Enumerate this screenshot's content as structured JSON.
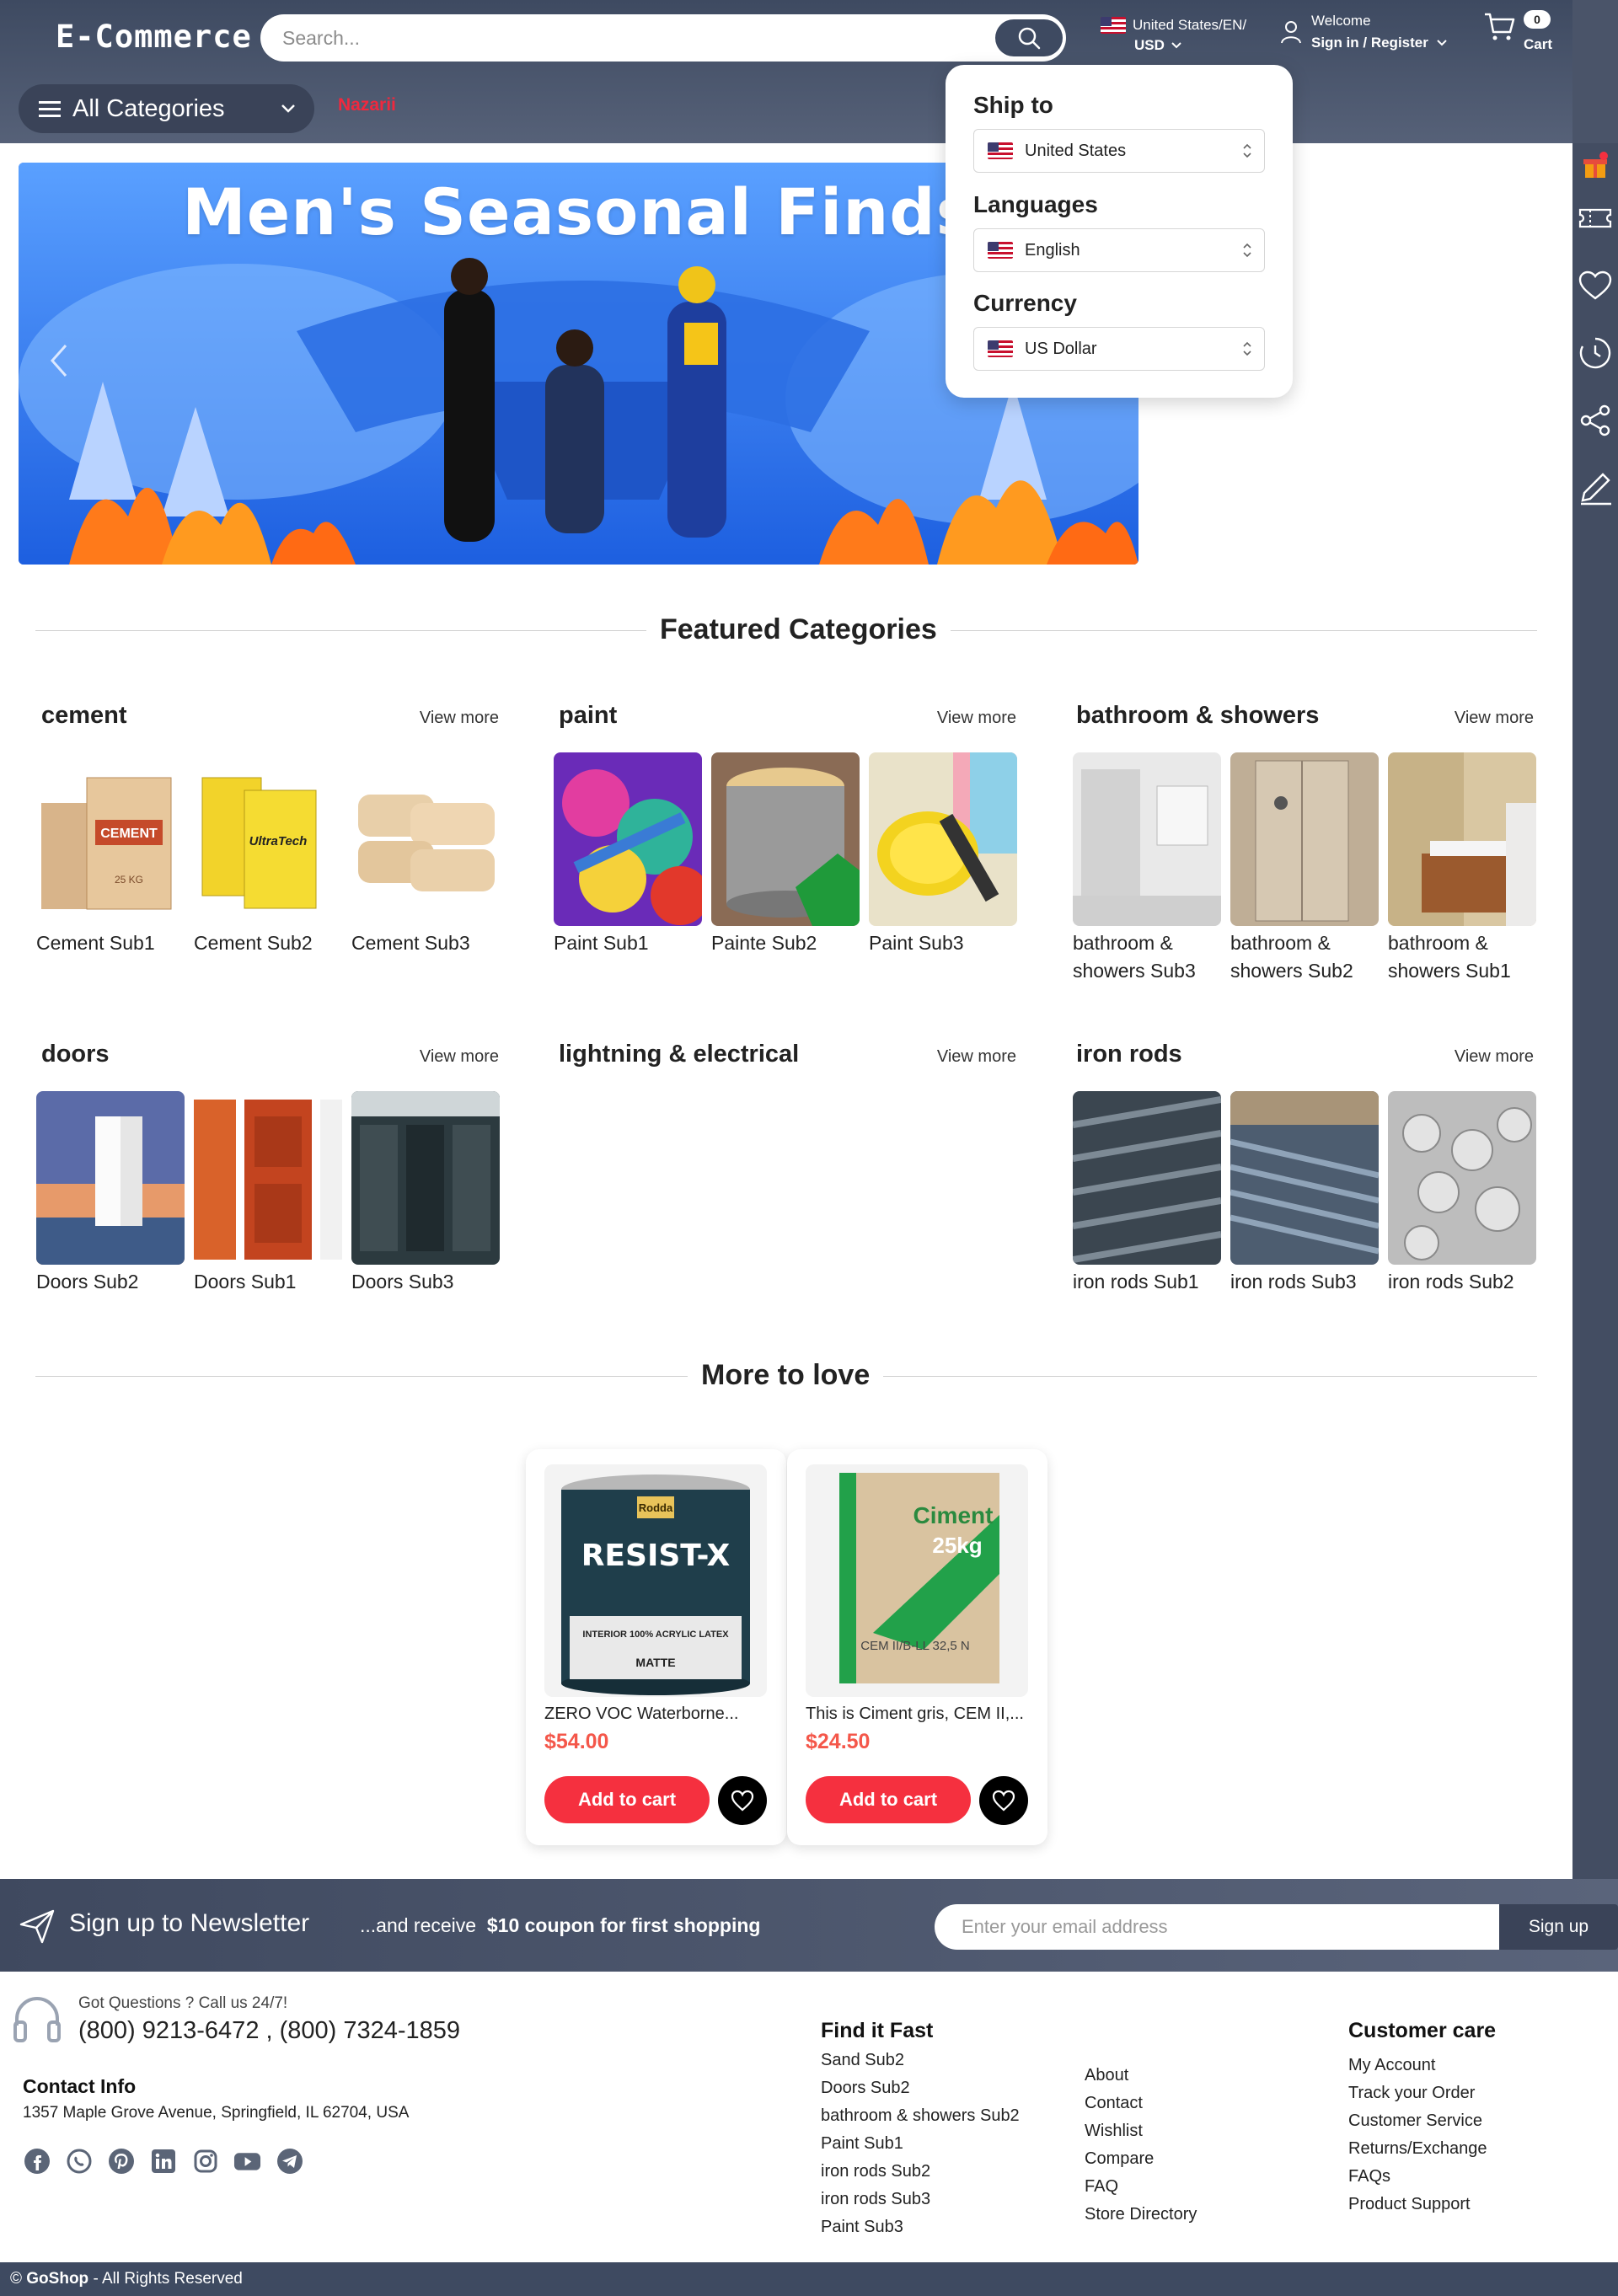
{
  "header": {
    "logo": "E-Commerce",
    "search_placeholder": "Search...",
    "locale_line1": "United States/EN/",
    "locale_line2": "USD",
    "welcome": "Welcome",
    "sign_in": "Sign in / Register",
    "cart_count": "0",
    "cart_label": "Cart",
    "all_categories": "All Categories",
    "nav_link": "Nazarii"
  },
  "dropdown": {
    "ship_to_title": "Ship to",
    "ship_to_value": "United States",
    "languages_title": "Languages",
    "languages_value": "English",
    "currency_title": "Currency",
    "currency_value": "US Dollar"
  },
  "hero": {
    "title": "Men's Seasonal Finds"
  },
  "featured": {
    "title": "Featured Categories",
    "view_more": "View more",
    "categories": [
      {
        "name": "cement",
        "items": [
          "Cement Sub1",
          "Cement Sub2",
          "Cement Sub3"
        ]
      },
      {
        "name": "paint",
        "items": [
          "Paint Sub1",
          "Painte Sub2",
          "Paint Sub3"
        ]
      },
      {
        "name": "bathroom & showers",
        "items": [
          "bathroom & showers Sub3",
          "bathroom & showers Sub2",
          "bathroom & showers Sub1"
        ]
      },
      {
        "name": "doors",
        "items": [
          "Doors Sub2",
          "Doors Sub1",
          "Doors Sub3"
        ]
      },
      {
        "name": "lightning & electrical",
        "items": []
      },
      {
        "name": "iron rods",
        "items": [
          "iron rods Sub1",
          "iron rods Sub3",
          "iron rods Sub2"
        ]
      }
    ]
  },
  "more_to_love": {
    "title": "More to love",
    "products": [
      {
        "name": "ZERO VOC Waterborne...",
        "price": "$54.00",
        "add_label": "Add to cart",
        "image_text_brand": "Rodda",
        "image_text_product": "RESIST-X",
        "image_text_desc": "INTERIOR 100% ACRYLIC LATEX",
        "image_text_finish": "MATTE"
      },
      {
        "name": "This is Ciment gris, CEM II,...",
        "price": "$24.50",
        "add_label": "Add to cart",
        "image_text_brand": "Ciment",
        "image_text_weight": "25kg",
        "image_text_spec": "CEM II/B-LL 32,5 N"
      }
    ]
  },
  "newsletter": {
    "title": "Sign up to Newsletter",
    "receive": "...and receive",
    "coupon": "$10 coupon for first shopping",
    "placeholder": "Enter your email address",
    "button": "Sign up"
  },
  "footer": {
    "questions": "Got Questions ? Call us 24/7!",
    "phones": "(800) 9213-6472 , (800) 7324-1859",
    "contact_title": "Contact Info",
    "address": "1357 Maple Grove Avenue, Springfield, IL 62704, USA",
    "find_title": "Find it Fast",
    "find_links": [
      "Sand Sub2",
      "Doors Sub2",
      "bathroom & showers Sub2",
      "Paint Sub1",
      "iron rods Sub2",
      "iron rods Sub3",
      "Paint Sub3"
    ],
    "info_links": [
      "About",
      "Contact",
      "Wishlist",
      "Compare",
      "FAQ",
      "Store Directory"
    ],
    "care_title": "Customer care",
    "care_links": [
      "My Account",
      "Track your Order",
      "Customer Service",
      "Returns/Exchange",
      "FAQs",
      "Product Support"
    ],
    "copyright_brand": "GoShop",
    "copyright_rest": "- All Rights Reserved"
  },
  "colors": {
    "header_bg": "#3e4a61",
    "accent_red": "#f5303f",
    "price_orange": "#f4574a"
  }
}
